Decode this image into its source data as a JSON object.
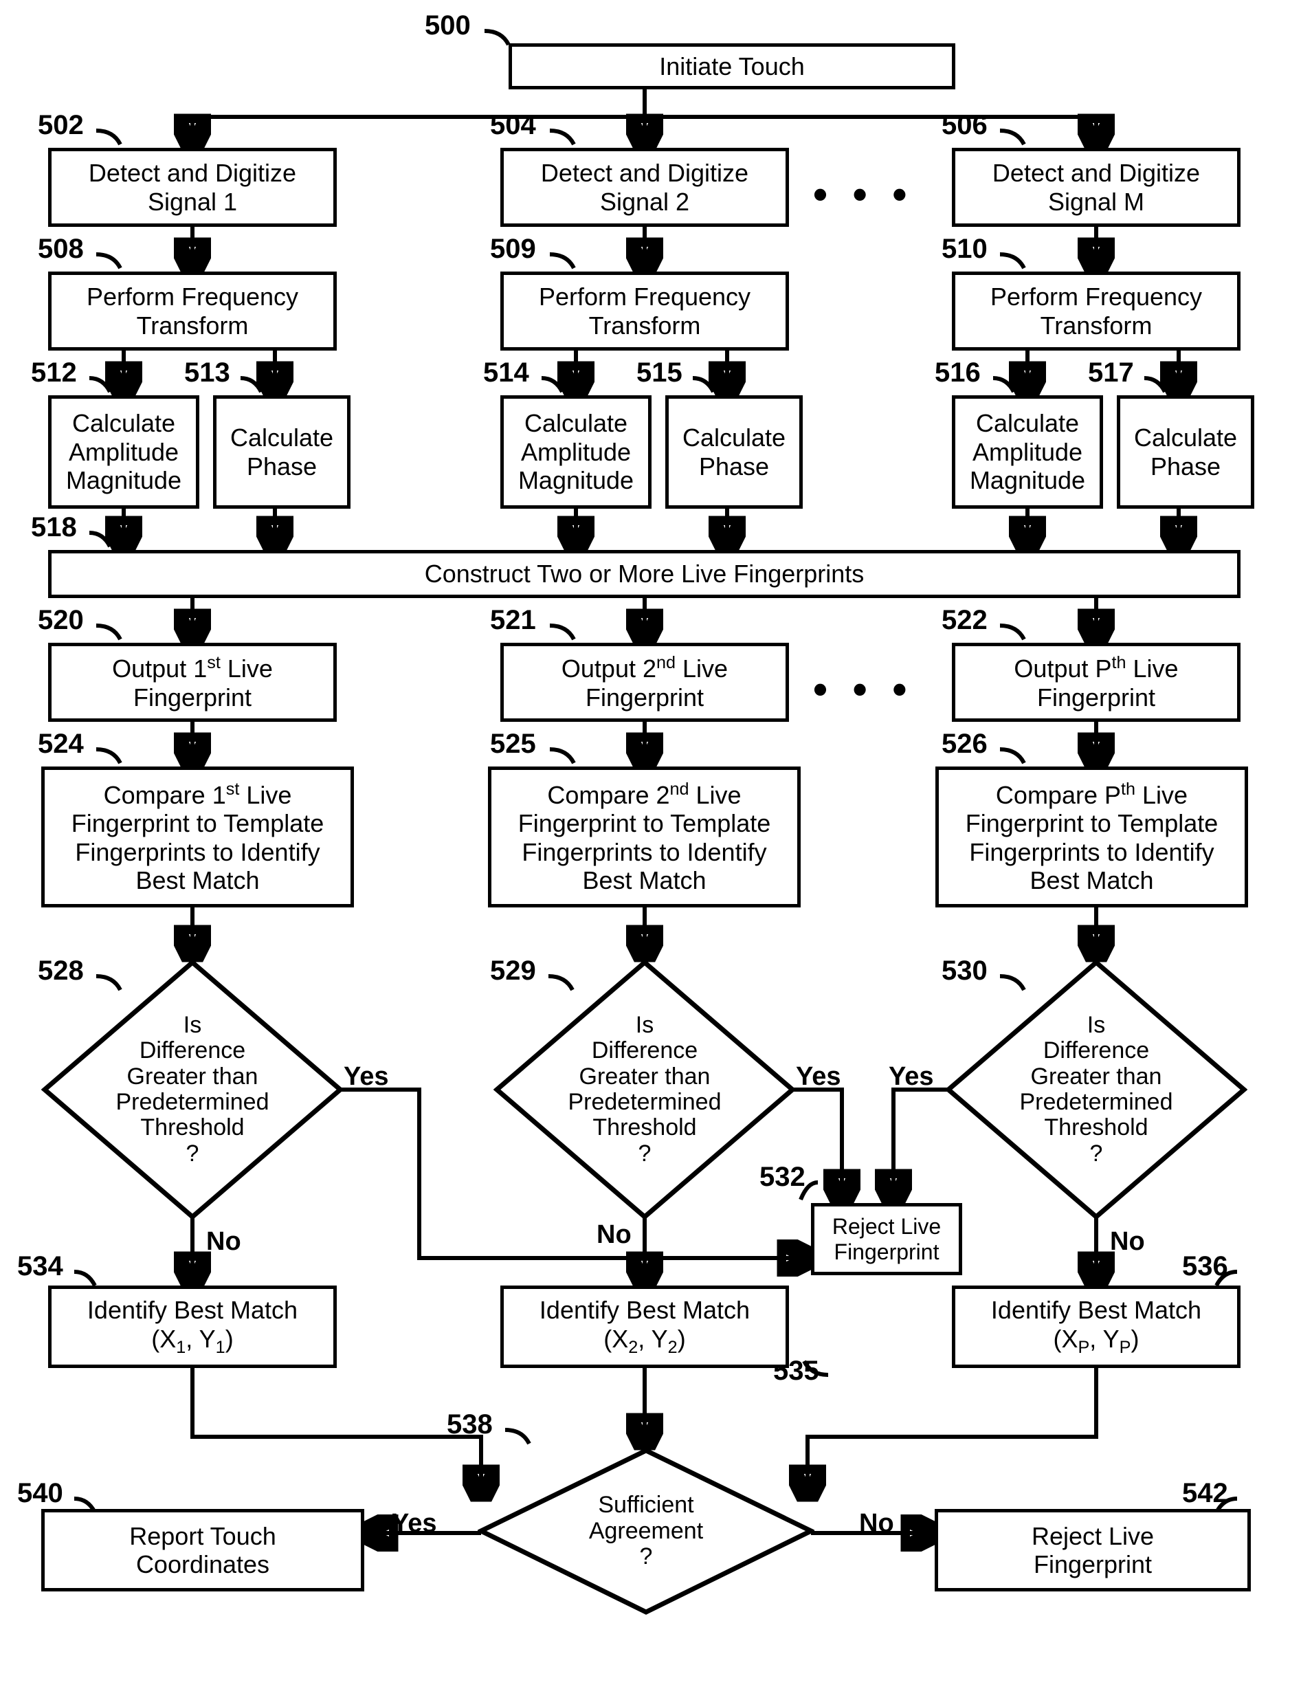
{
  "labels": {
    "n500": "500",
    "n502": "502",
    "n504": "504",
    "n506": "506",
    "n508": "508",
    "n509": "509",
    "n510": "510",
    "n512": "512",
    "n513": "513",
    "n514": "514",
    "n515": "515",
    "n516": "516",
    "n517": "517",
    "n518": "518",
    "n520": "520",
    "n521": "521",
    "n522": "522",
    "n524": "524",
    "n525": "525",
    "n526": "526",
    "n528": "528",
    "n529": "529",
    "n530": "530",
    "n532": "532",
    "n534": "534",
    "n535": "535",
    "n536": "536",
    "n538": "538",
    "n540": "540",
    "n542": "542"
  },
  "boxes": {
    "b500": "Initiate Touch",
    "b502_l1": "Detect and Digitize",
    "b502_l2": "Signal 1",
    "b504_l1": "Detect and Digitize",
    "b504_l2": "Signal 2",
    "b506_l1": "Detect and Digitize",
    "b506_l2": "Signal M",
    "b508_l1": "Perform Frequency",
    "b508_l2": "Transform",
    "b509_l1": "Perform Frequency",
    "b509_l2": "Transform",
    "b510_l1": "Perform Frequency",
    "b510_l2": "Transform",
    "b512_l1": "Calculate",
    "b512_l2": "Amplitude",
    "b512_l3": "Magnitude",
    "b513_l1": "Calculate",
    "b513_l2": "Phase",
    "b514_l1": "Calculate",
    "b514_l2": "Amplitude",
    "b514_l3": "Magnitude",
    "b515_l1": "Calculate",
    "b515_l2": "Phase",
    "b516_l1": "Calculate",
    "b516_l2": "Amplitude",
    "b516_l3": "Magnitude",
    "b517_l1": "Calculate",
    "b517_l2": "Phase",
    "b518": "Construct Two or More Live Fingerprints",
    "b520_pre": "Output 1",
    "b520_sup": "st",
    "b520_post": " Live",
    "b520_l2": "Fingerprint",
    "b521_pre": "Output 2",
    "b521_sup": "nd",
    "b521_post": " Live",
    "b521_l2": "Fingerprint",
    "b522_pre": "Output P",
    "b522_sup": "th",
    "b522_post": " Live",
    "b522_l2": "Fingerprint",
    "b524_pre": "Compare 1",
    "b524_sup": "st",
    "b524_post": " Live",
    "b524_l2": "Fingerprint to Template",
    "b524_l3": "Fingerprints to Identify",
    "b524_l4": "Best Match",
    "b525_pre": "Compare 2",
    "b525_sup": "nd",
    "b525_post": " Live",
    "b525_l2": "Fingerprint to Template",
    "b525_l3": "Fingerprints to Identify",
    "b525_l4": "Best Match",
    "b526_pre": "Compare P",
    "b526_sup": "th",
    "b526_post": " Live",
    "b526_l2": "Fingerprint to Template",
    "b526_l3": "Fingerprints to Identify",
    "b526_l4": "Best Match",
    "d528_l1": "Is",
    "d528_l2": "Difference",
    "d528_l3": "Greater than",
    "d528_l4": "Predetermined",
    "d528_l5": "Threshold",
    "d528_l6": "?",
    "d529_l1": "Is",
    "d529_l2": "Difference",
    "d529_l3": "Greater than",
    "d529_l4": "Predetermined",
    "d529_l5": "Threshold",
    "d529_l6": "?",
    "d530_l1": "Is",
    "d530_l2": "Difference",
    "d530_l3": "Greater than",
    "d530_l4": "Predetermined",
    "d530_l5": "Threshold",
    "d530_l6": "?",
    "b532_l1": "Reject Live",
    "b532_l2": "Fingerprint",
    "b534_l1": "Identify Best Match",
    "b534_X": "(X",
    "b534_1a": "1",
    "b534_c": ", Y",
    "b534_1b": "1",
    "b534_e": ")",
    "b535_l1": "Identify Best Match",
    "b535_X": "(X",
    "b535_2a": "2",
    "b535_c": ", Y",
    "b535_2b": "2",
    "b535_e": ")",
    "b536_l1": "Identify Best Match",
    "b536_X": "(X",
    "b536_Pa": "P",
    "b536_c": ", Y",
    "b536_Pb": "P",
    "b536_e": ")",
    "d538_l1": "Sufficient",
    "d538_l2": "Agreement",
    "d538_l3": "?",
    "b540_l1": "Report Touch",
    "b540_l2": "Coordinates",
    "b542_l1": "Reject Live",
    "b542_l2": "Fingerprint"
  },
  "edges": {
    "yes": "Yes",
    "no": "No"
  },
  "dots": "• • •"
}
